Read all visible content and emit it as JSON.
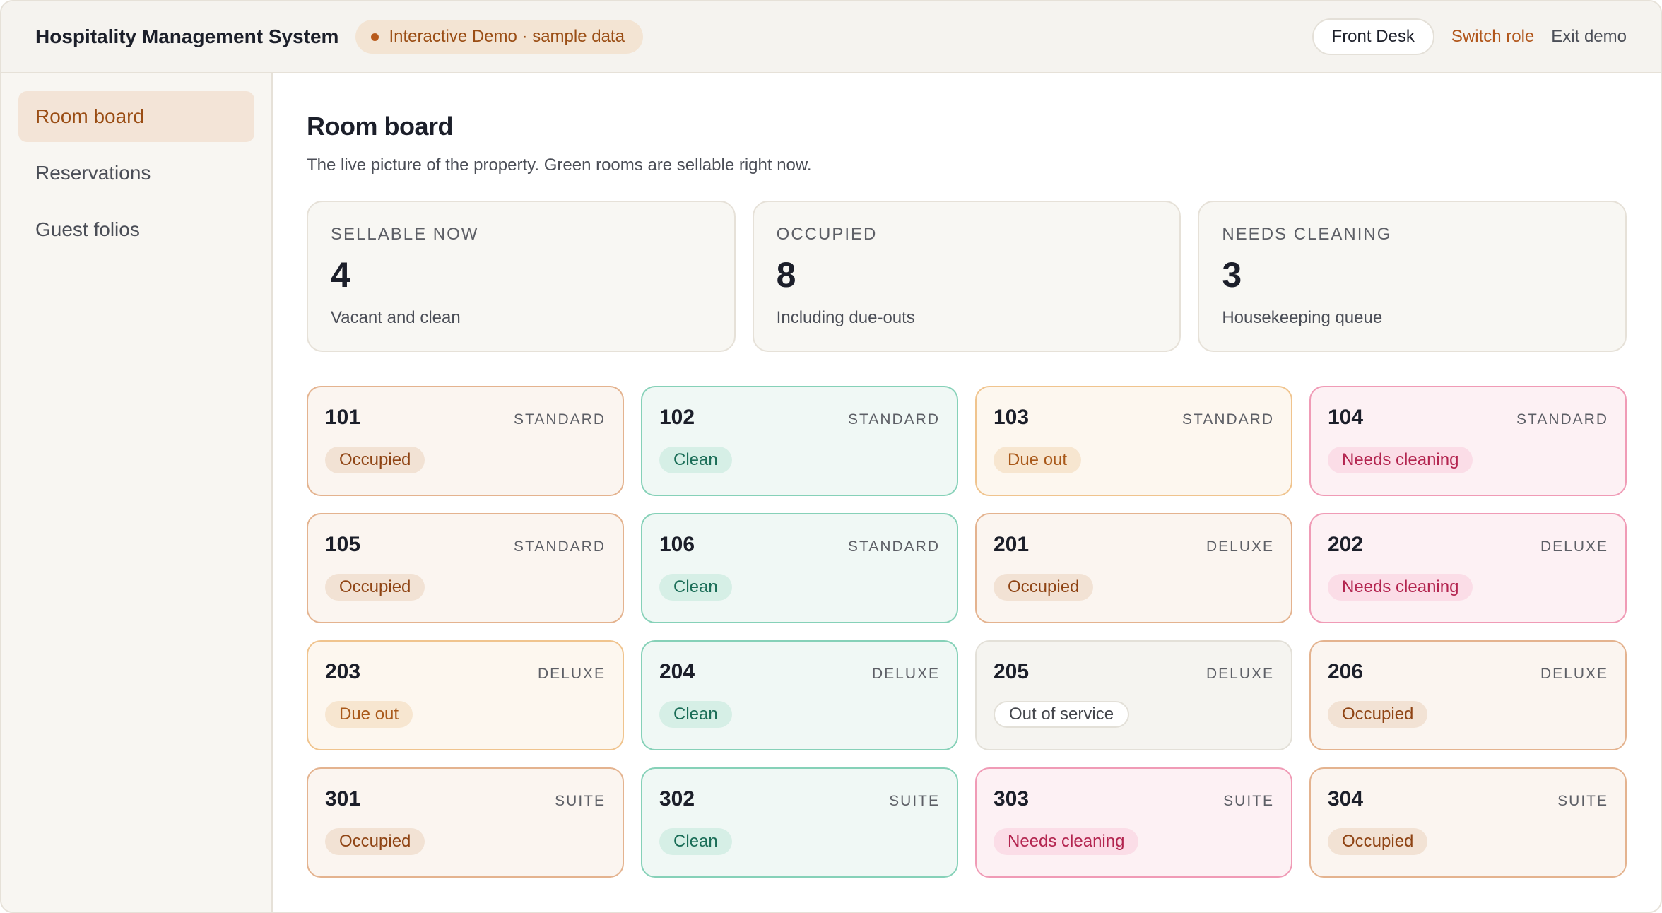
{
  "header": {
    "app_title": "Hospitality Management System",
    "demo_badge": "Interactive Demo · sample data",
    "role": "Front Desk",
    "switch_role": "Switch role",
    "exit_demo": "Exit demo"
  },
  "sidebar": {
    "items": [
      {
        "label": "Room board",
        "active": true
      },
      {
        "label": "Reservations",
        "active": false
      },
      {
        "label": "Guest folios",
        "active": false
      }
    ]
  },
  "page": {
    "title": "Room board",
    "subtitle": "The live picture of the property. Green rooms are sellable right now."
  },
  "stats": [
    {
      "label": "SELLABLE NOW",
      "value": "4",
      "note": "Vacant and clean"
    },
    {
      "label": "OCCUPIED",
      "value": "8",
      "note": "Including due-outs"
    },
    {
      "label": "NEEDS CLEANING",
      "value": "3",
      "note": "Housekeeping queue"
    }
  ],
  "rooms": [
    {
      "number": "101",
      "type": "STANDARD",
      "status": "Occupied",
      "status_key": "occupied"
    },
    {
      "number": "102",
      "type": "STANDARD",
      "status": "Clean",
      "status_key": "clean"
    },
    {
      "number": "103",
      "type": "STANDARD",
      "status": "Due out",
      "status_key": "dueout"
    },
    {
      "number": "104",
      "type": "STANDARD",
      "status": "Needs cleaning",
      "status_key": "needs"
    },
    {
      "number": "105",
      "type": "STANDARD",
      "status": "Occupied",
      "status_key": "occupied"
    },
    {
      "number": "106",
      "type": "STANDARD",
      "status": "Clean",
      "status_key": "clean"
    },
    {
      "number": "201",
      "type": "DELUXE",
      "status": "Occupied",
      "status_key": "occupied"
    },
    {
      "number": "202",
      "type": "DELUXE",
      "status": "Needs cleaning",
      "status_key": "needs"
    },
    {
      "number": "203",
      "type": "DELUXE",
      "status": "Due out",
      "status_key": "dueout"
    },
    {
      "number": "204",
      "type": "DELUXE",
      "status": "Clean",
      "status_key": "clean"
    },
    {
      "number": "205",
      "type": "DELUXE",
      "status": "Out of service",
      "status_key": "oos"
    },
    {
      "number": "206",
      "type": "DELUXE",
      "status": "Occupied",
      "status_key": "occupied"
    },
    {
      "number": "301",
      "type": "SUITE",
      "status": "Occupied",
      "status_key": "occupied"
    },
    {
      "number": "302",
      "type": "SUITE",
      "status": "Clean",
      "status_key": "clean"
    },
    {
      "number": "303",
      "type": "SUITE",
      "status": "Needs cleaning",
      "status_key": "needs"
    },
    {
      "number": "304",
      "type": "SUITE",
      "status": "Occupied",
      "status_key": "occupied"
    }
  ],
  "colors": {
    "accent": "#b1561b",
    "occupied": "#e4b38f",
    "clean": "#86d1b8",
    "due_out": "#f0c48e",
    "needs_cleaning": "#f09bb6",
    "out_of_service": "#e3e0d8"
  }
}
